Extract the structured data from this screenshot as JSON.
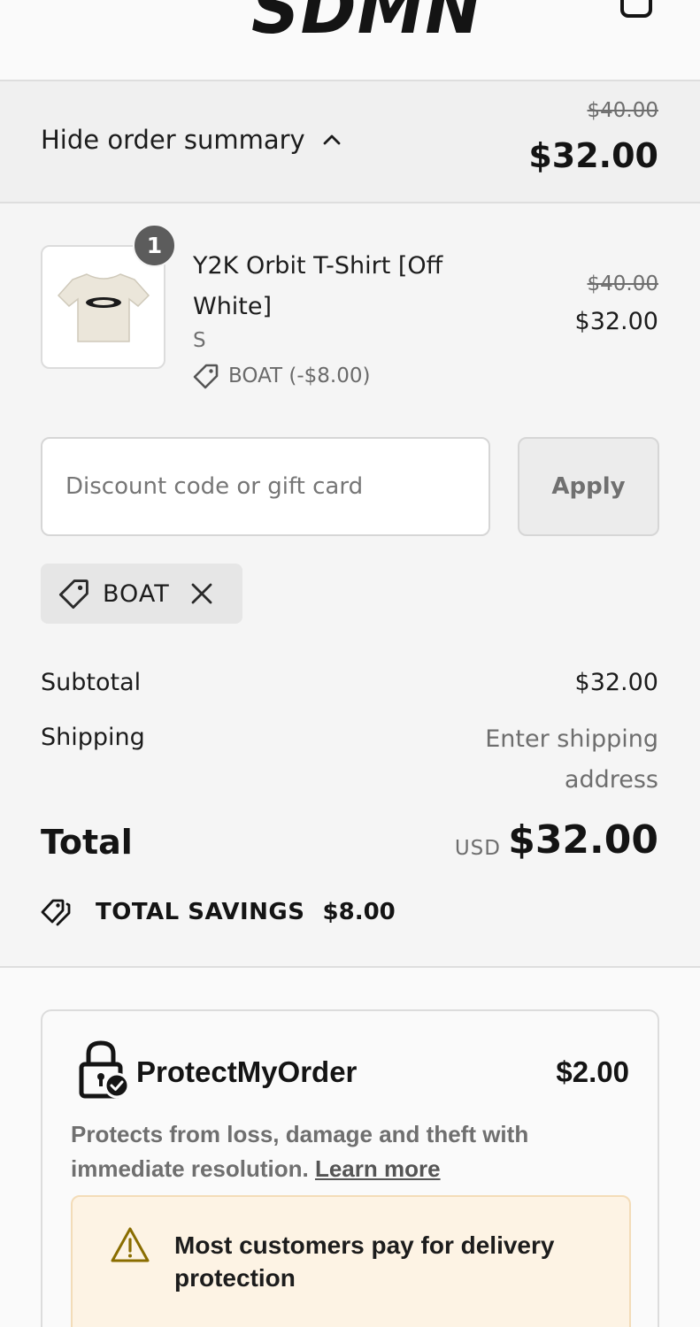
{
  "header": {
    "logo_text": "SDMN"
  },
  "order_summary": {
    "toggle_label": "Hide order summary",
    "original_total": "$40.00",
    "discounted_total": "$32.00"
  },
  "product": {
    "quantity": "1",
    "name": "Y2K Orbit T-Shirt [Off White]",
    "variant": "S",
    "discount_label": "BOAT (-$8.00)",
    "original_price": "$40.00",
    "price": "$32.00"
  },
  "discount": {
    "placeholder": "Discount code or gift card",
    "apply_label": "Apply",
    "applied_code": "BOAT"
  },
  "totals": {
    "subtotal_label": "Subtotal",
    "subtotal_value": "$32.00",
    "shipping_label": "Shipping",
    "shipping_value": "Enter shipping address",
    "total_label": "Total",
    "currency": "USD",
    "total_value": "$32.00",
    "savings_label": "TOTAL SAVINGS",
    "savings_value": "$8.00"
  },
  "protection": {
    "title": "ProtectMyOrder",
    "price": "$2.00",
    "description": "Protects from loss, damage and theft with immediate resolution.",
    "learn_more": "Learn more",
    "warning": "Most customers pay for delivery protection"
  },
  "colors": {
    "accent": "#141414",
    "warning_bg": "#fdf3e4",
    "warning_icon": "#8a6d00"
  },
  "icons": {
    "cart": "cart-icon",
    "chevron": "chevron-up-icon",
    "tag": "tag-icon",
    "close": "close-icon",
    "savings": "tags-icon",
    "lock": "lock-check-icon",
    "warning": "warning-icon"
  }
}
